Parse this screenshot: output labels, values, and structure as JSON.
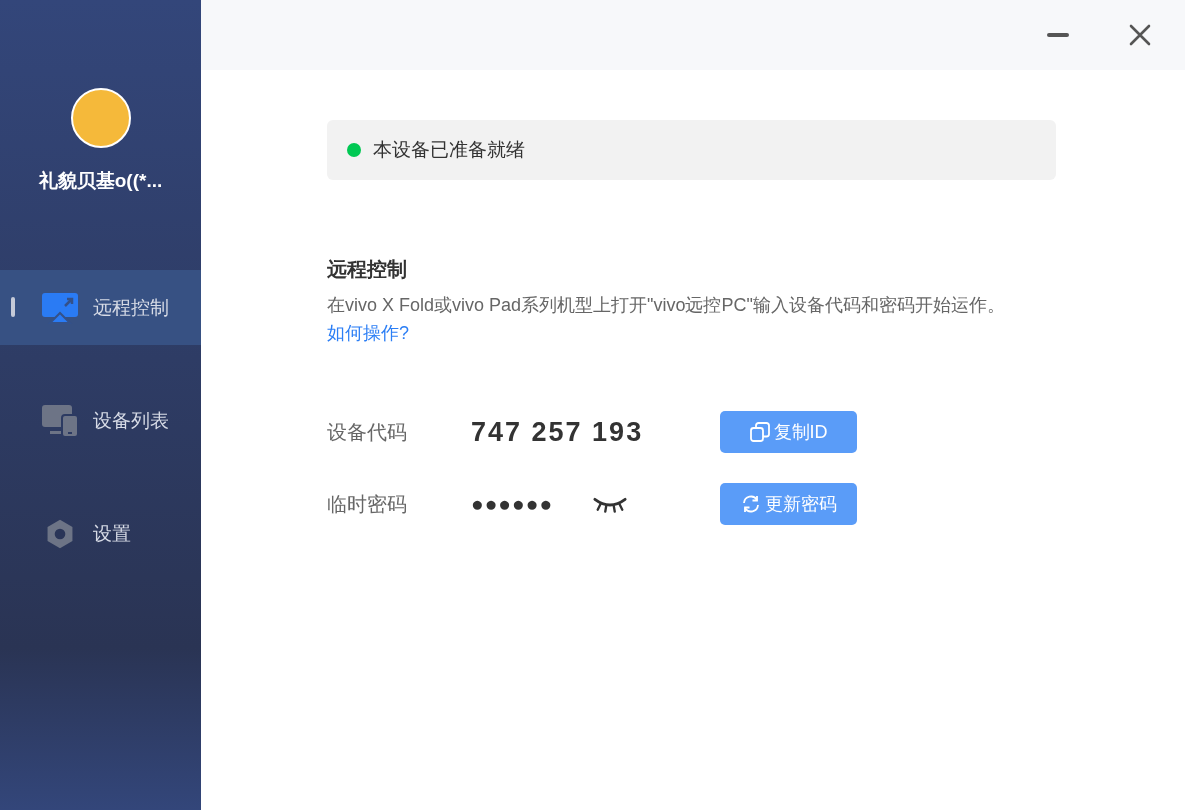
{
  "user": {
    "name": "礼貌贝基o((*..."
  },
  "nav": [
    {
      "label": "远程控制",
      "kind": "remote",
      "selected": true
    },
    {
      "label": "设备列表",
      "kind": "devices",
      "selected": false
    },
    {
      "label": "设置",
      "kind": "settings",
      "selected": false
    }
  ],
  "status": {
    "text": "本设备已准备就绪",
    "color": "#00c853"
  },
  "section": {
    "title": "远程控制",
    "description": "在vivo X Fold或vivo Pad系列机型上打开\"vivo远控PC\"输入设备代码和密码开始运作。",
    "link": "如何操作?"
  },
  "fields": [
    {
      "label": "设备代码",
      "value": "747 257 193",
      "kind": "code",
      "button": "复制ID"
    },
    {
      "label": "临时密码",
      "value": "●●●●●●",
      "kind": "password",
      "button": "更新密码"
    }
  ]
}
